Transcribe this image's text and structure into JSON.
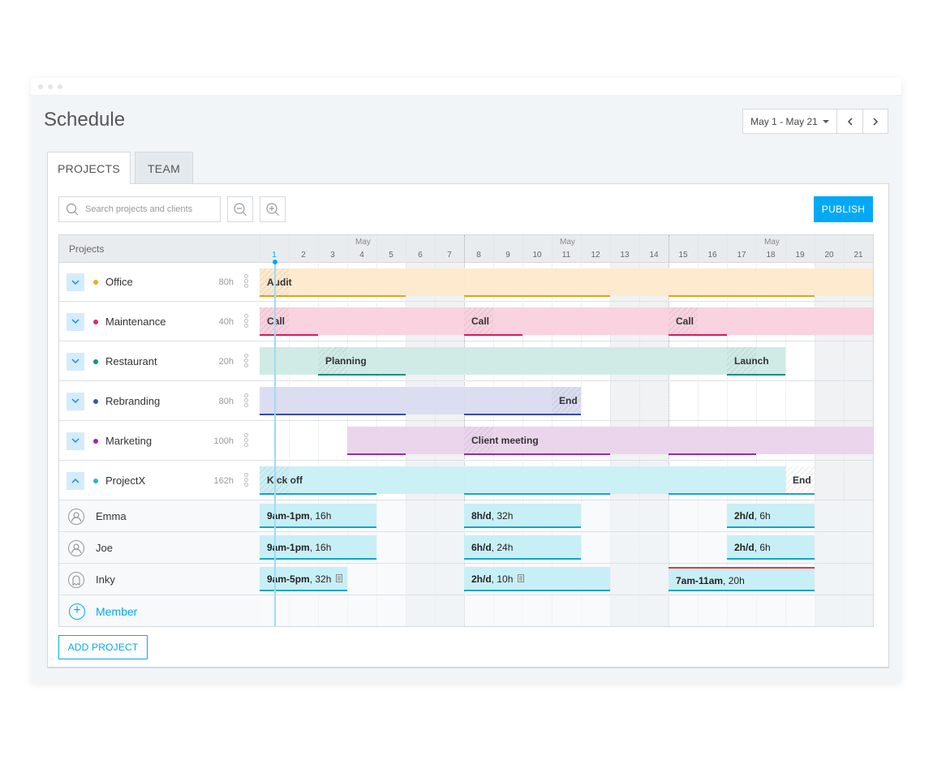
{
  "window": {
    "title": "Schedule"
  },
  "date_range": {
    "label": "May 1 - May 21",
    "prev_icon": "chevron-left-icon",
    "next_icon": "chevron-right-icon"
  },
  "tabs": [
    {
      "label": "PROJECTS"
    },
    {
      "label": "TEAM"
    }
  ],
  "toolbar": {
    "search_placeholder": "Search projects and clients",
    "publish_label": "PUBLISH",
    "add_project_label": "ADD PROJECT"
  },
  "grid": {
    "header_label": "Projects",
    "month_label": "May",
    "days": [
      "1",
      "2",
      "3",
      "4",
      "5",
      "6",
      "7",
      "8",
      "9",
      "10",
      "11",
      "12",
      "13",
      "14",
      "15",
      "16",
      "17",
      "18",
      "19",
      "20",
      "21"
    ]
  },
  "projects": [
    {
      "name": "Office",
      "hours": "80h",
      "color": "#f5a623",
      "expanded": false,
      "bar_color": "#fde9cc",
      "line_color": "#e6a117",
      "labels": [
        {
          "text": "Audit",
          "day": 1
        }
      ]
    },
    {
      "name": "Maintenance",
      "hours": "40h",
      "color": "#e0286a",
      "expanded": false,
      "bar_color": "#f9d1de",
      "line_color": "#d81b60",
      "labels": [
        {
          "text": "Call",
          "day": 1
        },
        {
          "text": "Call",
          "day": 8
        },
        {
          "text": "Call",
          "day": 15
        }
      ]
    },
    {
      "name": "Restaurant",
      "hours": "20h",
      "color": "#0e9480",
      "expanded": false,
      "bar_color": "#cdeae4",
      "line_color": "#10907d",
      "labels": [
        {
          "text": "Planning",
          "day": 3
        },
        {
          "text": "Launch",
          "day": 17
        }
      ]
    },
    {
      "name": "Rebranding",
      "hours": "80h",
      "color": "#3f51b5",
      "expanded": false,
      "bar_color": "#d9dbf0",
      "line_color": "#3949ab",
      "labels": [
        {
          "text": "End",
          "day": 11
        }
      ]
    },
    {
      "name": "Marketing",
      "hours": "100h",
      "color": "#9c27b0",
      "expanded": false,
      "bar_color": "#ead3ec",
      "line_color": "#9c27b0",
      "labels": [
        {
          "text": "Client meeting",
          "day": 8
        }
      ]
    },
    {
      "name": "ProjectX",
      "hours": "162h",
      "color": "#22b8d6",
      "expanded": true,
      "bar_color": "#c8eff5",
      "line_color": "#12a9c9",
      "labels": [
        {
          "text": "Kick off",
          "day": 1
        },
        {
          "text": "End",
          "day": 19
        }
      ]
    }
  ],
  "members": [
    {
      "name": "Emma",
      "avatar": "user-avatar-icon",
      "assignments": [
        {
          "bold": "9am-1pm",
          "rest": ", 16h"
        },
        {
          "bold": "8h/d",
          "rest": ", 32h"
        },
        {
          "bold": "2h/d",
          "rest": ", 6h"
        }
      ]
    },
    {
      "name": "Joe",
      "avatar": "user-avatar-icon",
      "assignments": [
        {
          "bold": "9am-1pm",
          "rest": ", 16h"
        },
        {
          "bold": "6h/d",
          "rest": ", 24h"
        },
        {
          "bold": "2h/d",
          "rest": ", 6h"
        }
      ]
    },
    {
      "name": "Inky",
      "avatar": "ghost-avatar-icon",
      "assignments": [
        {
          "bold": "9am-5pm",
          "rest": ", 32h"
        },
        {
          "bold": "2h/d",
          "rest": ", 10h"
        },
        {
          "bold": "7am-11am",
          "rest": ", 20h"
        }
      ]
    }
  ],
  "add_member_label": "Member",
  "colors": {
    "accent": "#03a9f4"
  }
}
